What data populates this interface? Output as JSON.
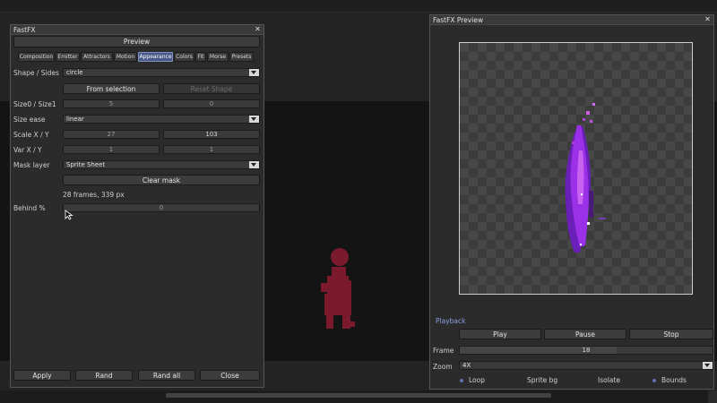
{
  "left_panel": {
    "title": "FastFX",
    "preview_button": "Preview",
    "tabs": [
      {
        "label": "Composition",
        "active": false
      },
      {
        "label": "Emitter",
        "active": false
      },
      {
        "label": "Attractors",
        "active": false
      },
      {
        "label": "Motion",
        "active": false
      },
      {
        "label": "Appearance",
        "active": true
      },
      {
        "label": "Colors",
        "active": false
      },
      {
        "label": "Fit",
        "active": false
      },
      {
        "label": "Morse",
        "active": false
      },
      {
        "label": "Presets",
        "active": false
      }
    ],
    "shape_label": "Shape / Sides",
    "shape_value": "circle",
    "from_selection": "From selection",
    "disabled_button": "Reset Shape",
    "size_label": "Size0 / Size1",
    "size0": "5",
    "size1": "0",
    "size_ease_label": "Size ease",
    "size_ease_value": "linear",
    "scale_label": "Scale X / Y",
    "scale_x": "27",
    "scale_y": "103",
    "var_label": "Var X / Y",
    "var_x": "1",
    "var_y": "1",
    "mask_label": "Mask layer",
    "mask_value": "Sprite Sheet",
    "clear_mask": "Clear mask",
    "frames_info": "28 frames, 339 px",
    "behind_label": "Behind %",
    "behind_value": "0",
    "footer_buttons": {
      "apply": "Apply",
      "rand": "Rand",
      "rand_all": "Rand all",
      "close": "Close"
    }
  },
  "right_panel": {
    "title": "FastFX Preview",
    "playback_label": "Playback",
    "play": "Play",
    "pause": "Pause",
    "stop": "Stop",
    "frame_label": "Frame",
    "frame_value": "18",
    "zoom_label": "Zoom",
    "zoom_value": "4X",
    "checks": {
      "loop": "Loop",
      "sprite_bg": "Sprite bg",
      "isolate": "Isolate",
      "bounds": "Bounds"
    }
  },
  "colors": {
    "accent": "#4a5a88",
    "figure": "#7a1a2c",
    "flame": "#9a30e8"
  }
}
